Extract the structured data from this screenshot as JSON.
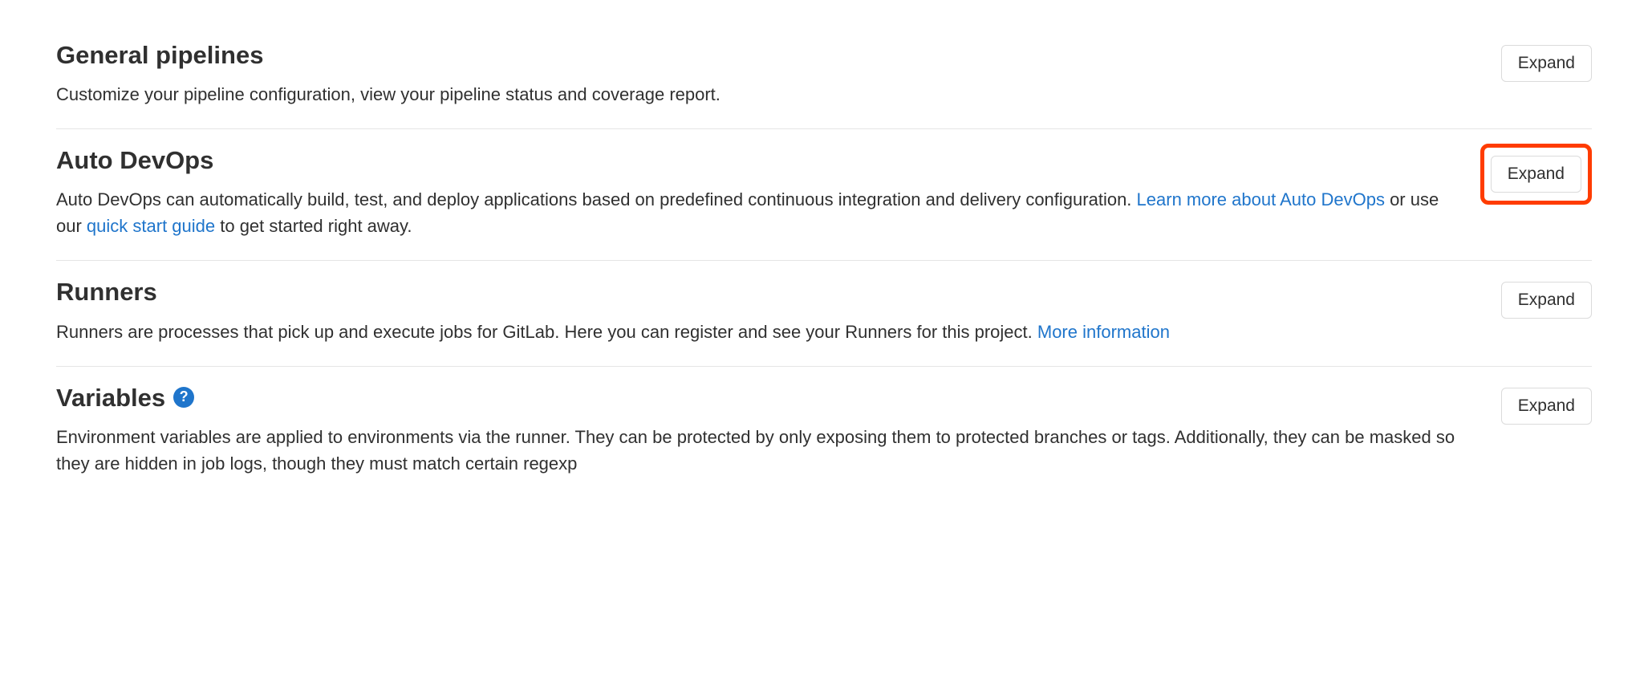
{
  "sections": {
    "general": {
      "title": "General pipelines",
      "desc": "Customize your pipeline configuration, view your pipeline status and coverage report.",
      "expand": "Expand"
    },
    "autodevops": {
      "title": "Auto DevOps",
      "desc_pre": "Auto DevOps can automatically build, test, and deploy applications based on predefined continuous integration and delivery configuration. ",
      "link1": "Learn more about Auto DevOps",
      "desc_mid": " or use our ",
      "link2": "quick start guide",
      "desc_post": " to get started right away.",
      "expand": "Expand"
    },
    "runners": {
      "title": "Runners",
      "desc_pre": "Runners are processes that pick up and execute jobs for GitLab. Here you can register and see your Runners for this project. ",
      "link1": "More information",
      "expand": "Expand"
    },
    "variables": {
      "title": "Variables",
      "help_glyph": "?",
      "desc": "Environment variables are applied to environments via the runner. They can be protected by only exposing them to protected branches or tags. Additionally, they can be masked so they are hidden in job logs, though they must match certain regexp",
      "expand": "Expand"
    }
  }
}
